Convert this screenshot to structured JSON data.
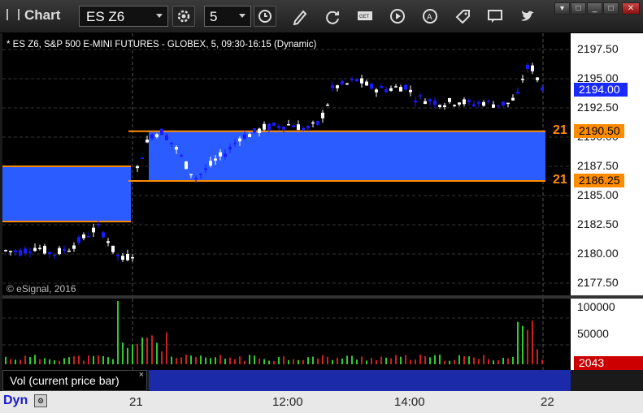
{
  "window": {
    "title": "Chart"
  },
  "toolbar": {
    "symbol": "ES Z6",
    "interval": "5",
    "icons": [
      "settings-gear-icon",
      "clock-icon",
      "pencil-icon",
      "refresh-icon",
      "get-data-icon",
      "play-icon",
      "alert-icon",
      "tag-icon",
      "comment-icon",
      "twitter-icon"
    ]
  },
  "chart": {
    "info": "* ES Z6, S&P 500 E-MINI FUTURES - GLOBEX, 5, 09:30-16:15 (Dynamic)",
    "copyright": "© eSignal, 2016",
    "price_ticks": [
      "2197.50",
      "2195.00",
      "2192.50",
      "2190.00",
      "2187.50",
      "2185.00",
      "2182.50",
      "2180.00",
      "2177.50"
    ],
    "current_price": "2194.00",
    "levels": [
      {
        "tag": "21",
        "price": "2190.50",
        "value": 2190.5
      },
      {
        "tag": "21",
        "price": "2186.25",
        "value": 2186.25
      }
    ],
    "colors": {
      "up": "#ffffff",
      "down": "#1a1aff",
      "zone": "#2a5cff",
      "level": "#ff8c00"
    }
  },
  "volume": {
    "legend": "Vol (current price bar)",
    "close_symbol": "×",
    "ticks": [
      "100000",
      "50000"
    ],
    "current": "2043"
  },
  "time_axis": {
    "dyn_label": "Dyn",
    "labels": [
      "21",
      "12:00",
      "14:00",
      "22"
    ]
  }
}
